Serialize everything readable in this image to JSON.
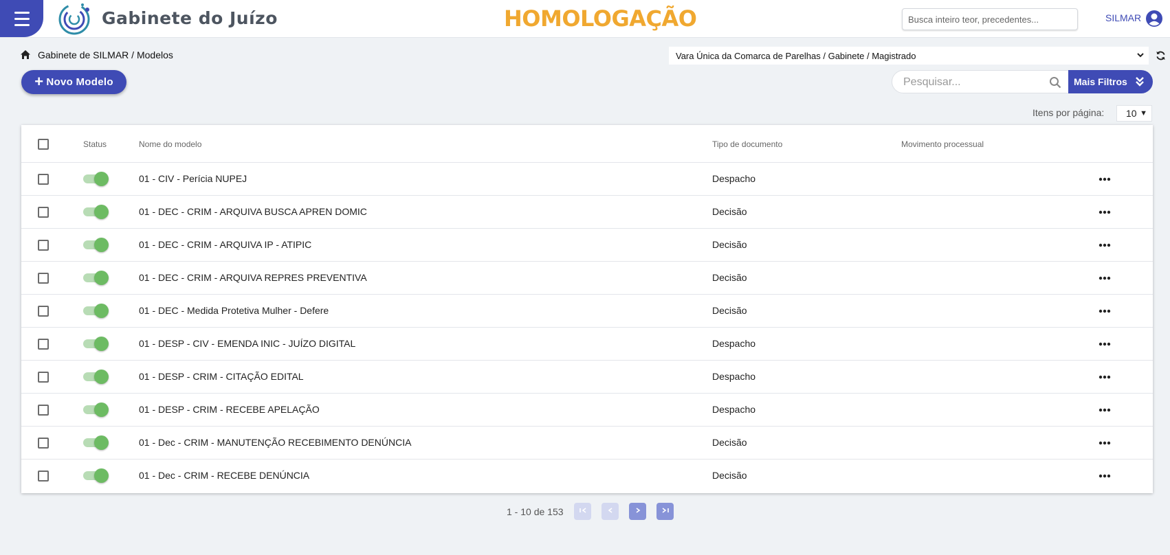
{
  "header": {
    "brand": "Gabinete do Juízo",
    "environment": "HOMOLOGAÇÃO",
    "search_placeholder": "Busca inteiro teor, precedentes...",
    "user": "SILMAR",
    "env_color": "#f0a830",
    "accent_color": "#3f4bb5"
  },
  "breadcrumb": {
    "icon": "home-icon",
    "text": "Gabinete de SILMAR / Modelos"
  },
  "unit_select": {
    "value": "Vara Única da Comarca de Parelhas / Gabinete / Magistrado"
  },
  "actions": {
    "new_label": "Novo Modelo",
    "search_placeholder": "Pesquisar...",
    "filters_label": "Mais Filtros",
    "per_page_label": "Itens por página:",
    "per_page_value": "10"
  },
  "table": {
    "columns": {
      "status": "Status",
      "name": "Nome do modelo",
      "type": "Tipo de documento",
      "movement": "Movimento processual"
    },
    "rows": [
      {
        "active": true,
        "name": "01 - CIV - Perícia NUPEJ",
        "type": "Despacho",
        "movement": ""
      },
      {
        "active": true,
        "name": "01 - DEC - CRIM - ARQUIVA BUSCA APREN DOMIC",
        "type": "Decisão",
        "movement": ""
      },
      {
        "active": true,
        "name": "01 - DEC - CRIM - ARQUIVA IP - ATIPIC",
        "type": "Decisão",
        "movement": ""
      },
      {
        "active": true,
        "name": "01 - DEC - CRIM - ARQUIVA REPRES PREVENTIVA",
        "type": "Decisão",
        "movement": ""
      },
      {
        "active": true,
        "name": "01 - DEC - Medida Protetiva Mulher - Defere",
        "type": "Decisão",
        "movement": ""
      },
      {
        "active": true,
        "name": "01 - DESP - CIV - EMENDA INIC - JUÍZO DIGITAL",
        "type": "Despacho",
        "movement": ""
      },
      {
        "active": true,
        "name": "01 - DESP - CRIM - CITAÇÃO EDITAL",
        "type": "Despacho",
        "movement": ""
      },
      {
        "active": true,
        "name": "01 - DESP - CRIM - RECEBE APELAÇÃO",
        "type": "Despacho",
        "movement": ""
      },
      {
        "active": true,
        "name": "01 - Dec - CRIM - MANUTENÇÃO RECEBIMENTO DENÚNCIA",
        "type": "Decisão",
        "movement": ""
      },
      {
        "active": true,
        "name": "01 - Dec - CRIM - RECEBE DENÚNCIA",
        "type": "Decisão",
        "movement": ""
      }
    ]
  },
  "pagination": {
    "range": "1 - 10 de 153"
  }
}
